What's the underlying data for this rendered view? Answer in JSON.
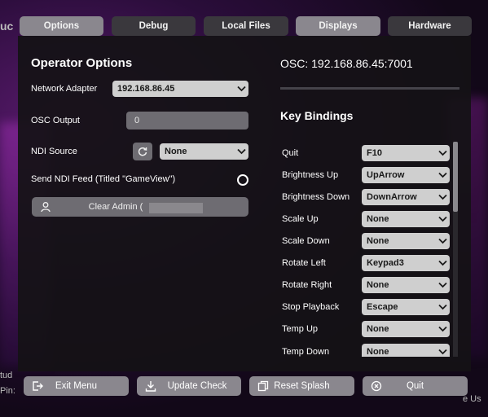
{
  "tabs": [
    {
      "label": "Options",
      "active": true
    },
    {
      "label": "Debug",
      "active": false
    },
    {
      "label": "Local Files",
      "active": false
    },
    {
      "label": "Displays",
      "active": true
    },
    {
      "label": "Hardware",
      "active": false
    }
  ],
  "operator": {
    "title": "Operator Options",
    "network_adapter_label": "Network Adapter",
    "network_adapter_value": "192.168.86.45",
    "osc_output_label": "OSC Output",
    "osc_output_value": "0",
    "ndi_source_label": "NDI Source",
    "ndi_source_value": "None",
    "send_ndi_label": "Send NDI Feed (Titled \"GameView\")",
    "clear_admin_label": "Clear Admin ("
  },
  "osc_address": "OSC: 192.168.86.45:7001",
  "key_bindings": {
    "title": "Key Bindings",
    "rows": [
      {
        "label": "Quit",
        "value": "F10"
      },
      {
        "label": "Brightness Up",
        "value": "UpArrow"
      },
      {
        "label": "Brightness Down",
        "value": "DownArrow"
      },
      {
        "label": "Scale Up",
        "value": "None"
      },
      {
        "label": "Scale Down",
        "value": "None"
      },
      {
        "label": "Rotate Left",
        "value": "Keypad3"
      },
      {
        "label": "Rotate Right",
        "value": "None"
      },
      {
        "label": "Stop Playback",
        "value": "Escape"
      },
      {
        "label": "Temp Up",
        "value": "None"
      },
      {
        "label": "Temp Down",
        "value": "None"
      }
    ]
  },
  "footer": {
    "exit": "Exit Menu",
    "update": "Update Check",
    "reset": "Reset Splash",
    "quit": "Quit"
  },
  "edge_text": {
    "left_top": "tud",
    "left_bottom": "Pin:",
    "right_bottom": "e Us",
    "top_left": "uc"
  },
  "colors": {
    "active_tab": "#8a878e",
    "inactive_tab": "#3a383d",
    "panel": "#141216",
    "dropdown": "#cfcfcf"
  }
}
